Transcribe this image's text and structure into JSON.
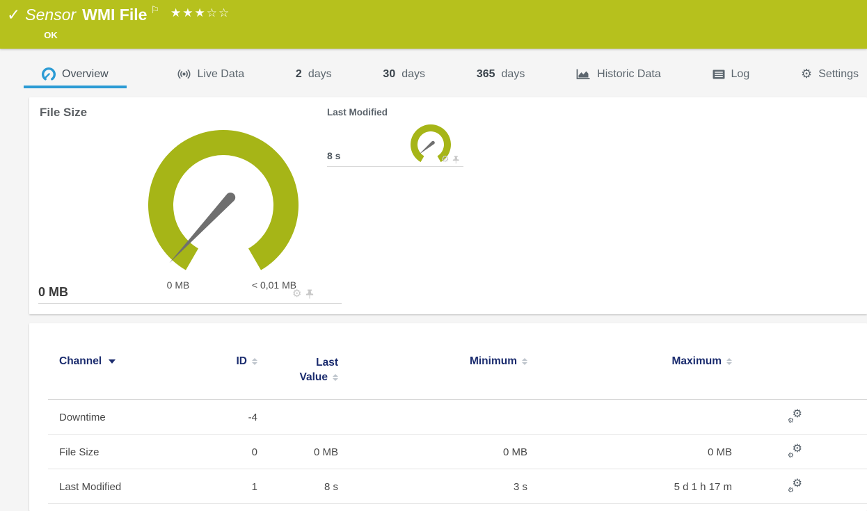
{
  "colors": {
    "status-green": "#b6c11d",
    "gauge-green": "#a6b517",
    "accent-blue": "#2b9bd4",
    "table-header-navy": "#1b2c6e"
  },
  "header": {
    "kind_label": "Sensor",
    "title": "WMI File",
    "status": "OK",
    "rating": {
      "filled": 3,
      "total": 5
    },
    "stars_filled": "★★★",
    "stars_empty": "☆☆"
  },
  "tabs": [
    {
      "label": "Overview",
      "icon": "gauge-icon",
      "active": true
    },
    {
      "label": "Live Data",
      "icon": "broadcast-icon"
    },
    {
      "bold": "2",
      "label": "days"
    },
    {
      "bold": "30",
      "label": "days"
    },
    {
      "bold": "365",
      "label": "days"
    },
    {
      "label": "Historic Data",
      "icon": "area-chart-icon"
    },
    {
      "label": "Log",
      "icon": "log-icon"
    },
    {
      "label": "Settings",
      "icon": "gear-icon"
    }
  ],
  "gauges": {
    "primary": {
      "title": "File Size",
      "value": "0 MB",
      "scale_min": "0 MB",
      "scale_max": "< 0,01 MB"
    },
    "secondary": {
      "title": "Last Modified",
      "value": "8 s"
    }
  },
  "channel_table": {
    "headers": {
      "channel": "Channel",
      "id": "ID",
      "last_value_line1": "Last",
      "last_value_line2": "Value",
      "minimum": "Minimum",
      "maximum": "Maximum"
    },
    "rows": [
      {
        "channel": "Downtime",
        "id": "-4",
        "last_value": "",
        "minimum": "",
        "maximum": ""
      },
      {
        "channel": "File Size",
        "id": "0",
        "last_value": "0 MB",
        "minimum": "0 MB",
        "maximum": "0 MB"
      },
      {
        "channel": "Last Modified",
        "id": "1",
        "last_value": "8 s",
        "minimum": "3 s",
        "maximum": "5 d 1 h 17 m"
      }
    ]
  }
}
